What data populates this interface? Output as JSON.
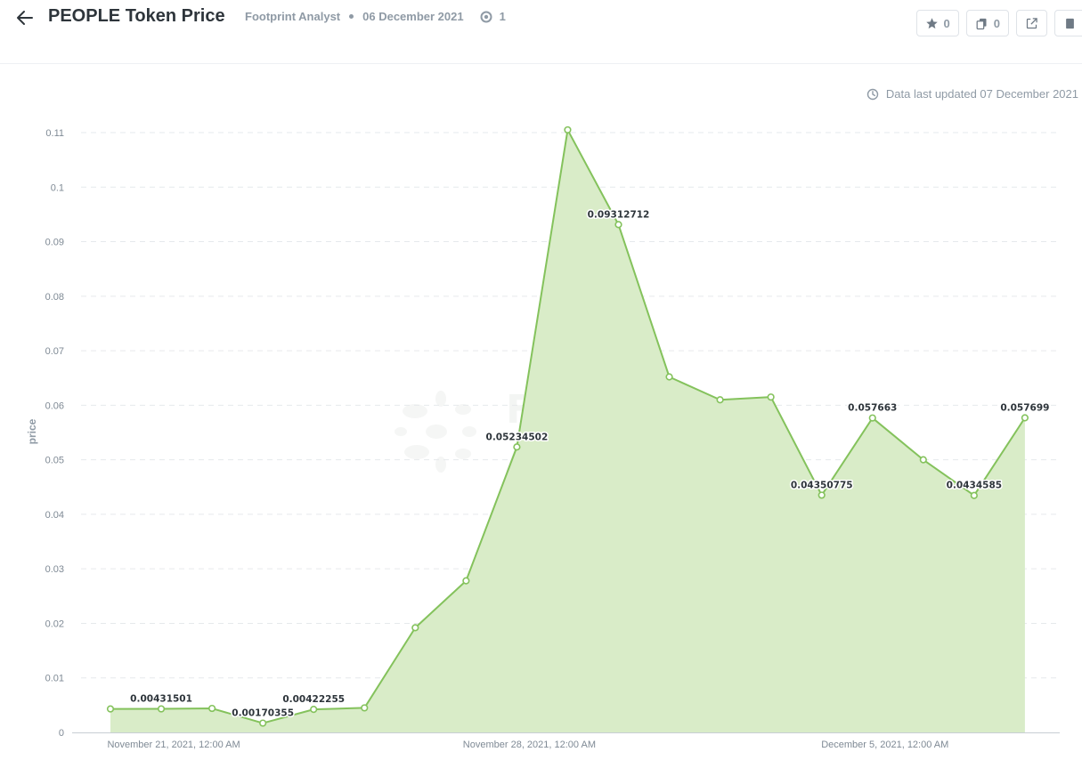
{
  "header": {
    "title": "PEOPLE Token Price",
    "author": "Footprint Analyst",
    "date": "06 December 2021",
    "views": "1",
    "favorite_count": "0",
    "copy_count": "0"
  },
  "status": {
    "updated_text": "Data last updated 07 December 2021"
  },
  "colors": {
    "line": "#84c25c",
    "area": "#d9ecc8",
    "grid": "#e6e9ec"
  },
  "chart_data": {
    "type": "area",
    "ylabel": "price",
    "ylim": [
      0,
      0.11
    ],
    "yticks": [
      "0",
      "0.01",
      "0.02",
      "0.03",
      "0.04",
      "0.05",
      "0.06",
      "0.07",
      "0.08",
      "0.09",
      "0.1",
      "0.11"
    ],
    "x": [
      "2021-11-20",
      "2021-11-21",
      "2021-11-22",
      "2021-11-23",
      "2021-11-24",
      "2021-11-25",
      "2021-11-26",
      "2021-11-27",
      "2021-11-28",
      "2021-11-29",
      "2021-11-30",
      "2021-12-01",
      "2021-12-02",
      "2021-12-03",
      "2021-12-04",
      "2021-12-05",
      "2021-12-06",
      "2021-12-07",
      "2021-12-08"
    ],
    "xticks": [
      {
        "date": "2021-11-21",
        "label": "November 21, 2021, 12:00 AM"
      },
      {
        "date": "2021-11-28",
        "label": "November 28, 2021, 12:00 AM"
      },
      {
        "date": "2021-12-05",
        "label": "December 5, 2021, 12:00 AM"
      }
    ],
    "series": [
      {
        "values": [
          0.0043,
          0.00431501,
          0.0044,
          0.00170355,
          0.00422255,
          0.0045,
          0.0192,
          0.0278,
          0.05234502,
          0.1105,
          0.09312712,
          0.0652,
          0.061,
          0.0615,
          0.04350775,
          0.057663,
          0.05,
          0.0434585,
          0.057699
        ],
        "labels": [
          "",
          "0.00431501",
          "",
          "0.00170355",
          "0.00422255",
          "",
          "",
          "",
          "0.05234502",
          "",
          "0.09312712",
          "",
          "",
          "",
          "0.04350775",
          "0.057663",
          "",
          "0.0434585",
          "0.057699"
        ]
      }
    ],
    "grid": true,
    "legend": "none",
    "watermark": "Footprint Analytics"
  }
}
